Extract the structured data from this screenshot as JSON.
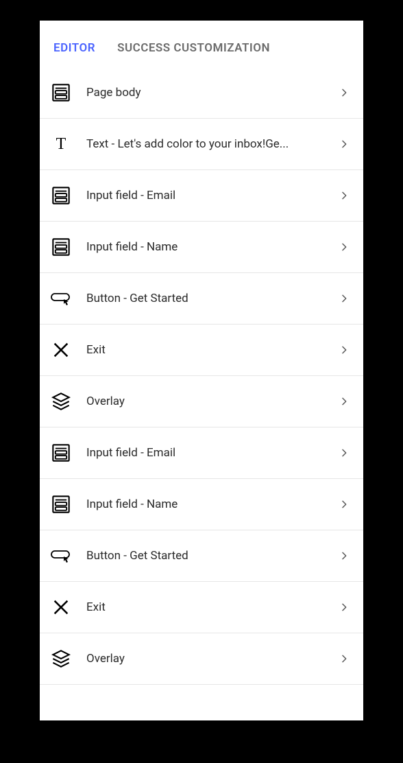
{
  "tabs": {
    "editor": "EDITOR",
    "success": "SUCCESS CUSTOMIZATION"
  },
  "items": [
    {
      "icon": "container",
      "label": "Page body"
    },
    {
      "icon": "text",
      "label": "Text - Let's add color to your inbox!Ge..."
    },
    {
      "icon": "container",
      "label": "Input field - Email"
    },
    {
      "icon": "container",
      "label": "Input field - Name"
    },
    {
      "icon": "button",
      "label": "Button - Get Started"
    },
    {
      "icon": "close",
      "label": "Exit"
    },
    {
      "icon": "layers",
      "label": "Overlay"
    },
    {
      "icon": "container",
      "label": "Input field - Email"
    },
    {
      "icon": "container",
      "label": "Input field - Name"
    },
    {
      "icon": "button",
      "label": "Button - Get Started"
    },
    {
      "icon": "close",
      "label": "Exit"
    },
    {
      "icon": "layers",
      "label": "Overlay"
    }
  ]
}
